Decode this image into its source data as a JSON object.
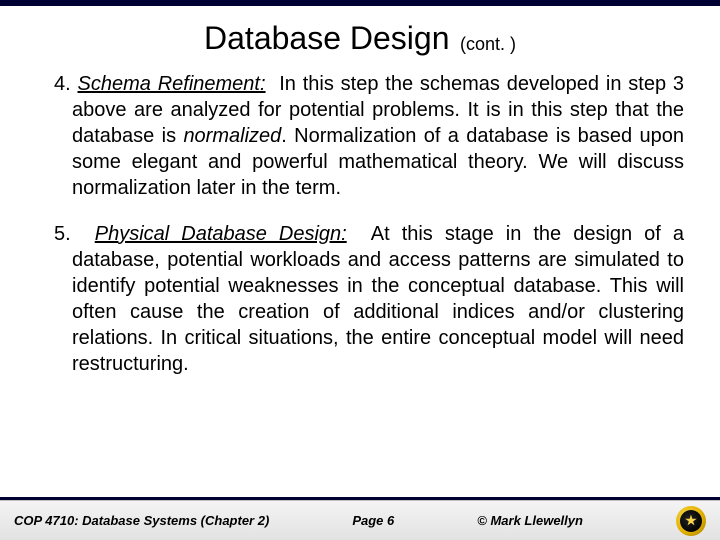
{
  "title": {
    "main": "Database Design",
    "cont": "(cont. )"
  },
  "items": [
    {
      "num": "4.",
      "term": "Schema Refinement:",
      "preface": "In this step the schemas developed in step 3 above are analyzed for potential problems.  It is in this step that the database is",
      "emph": "normalized",
      "tail": ".  Normalization of a database is based upon some elegant and powerful mathematical theory.  We will discuss normalization later in the term."
    },
    {
      "num": "5.",
      "term": "Physical Database Design:",
      "preface": "At this stage in the design of a database, potential workloads and access patterns are simulated to identify potential weaknesses in the conceptual database.  This will often cause the creation of additional indices and/or clustering relations.  In critical situations, the entire conceptual model will need restructuring.",
      "emph": "",
      "tail": ""
    }
  ],
  "footer": {
    "course": "COP 4710: Database Systems  (Chapter 2)",
    "page": "Page 6",
    "credit": "© Mark Llewellyn"
  }
}
